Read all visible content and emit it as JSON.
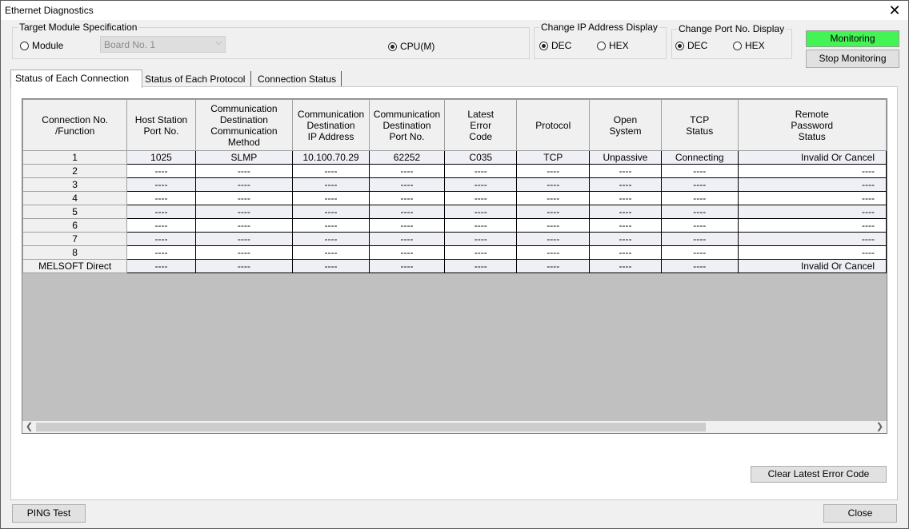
{
  "window": {
    "title": "Ethernet Diagnostics",
    "close_glyph": "✕"
  },
  "target": {
    "legend": "Target Module Specification",
    "module_label": "Module",
    "board_value": "Board No. 1",
    "cpu_label": "CPU(M)"
  },
  "ip_display": {
    "legend": "Change IP Address Display",
    "dec": "DEC",
    "hex": "HEX"
  },
  "port_display": {
    "legend": "Change Port No. Display",
    "dec": "DEC",
    "hex": "HEX"
  },
  "buttons": {
    "monitoring": "Monitoring",
    "stop_monitoring": "Stop Monitoring",
    "clear_error": "Clear Latest Error Code",
    "ping": "PING Test",
    "close": "Close"
  },
  "tabs": [
    "Status of Each Connection",
    "Status of Each Protocol",
    "Connection Status"
  ],
  "table": {
    "headers": [
      [
        "Connection No.",
        "/Function"
      ],
      [
        "Host Station",
        "Port No."
      ],
      [
        "Communication",
        "Destination",
        "Communication",
        "Method"
      ],
      [
        "Communication",
        "Destination",
        "IP Address"
      ],
      [
        "Communication",
        "Destination",
        "Port No."
      ],
      [
        "Latest",
        "Error",
        "Code"
      ],
      [
        "Protocol"
      ],
      [
        "Open",
        "System"
      ],
      [
        "TCP",
        "Status"
      ],
      [
        "Remote",
        "Password",
        "Status"
      ]
    ],
    "rows": [
      [
        "1",
        "1025",
        "SLMP",
        "10.100.70.29",
        "62252",
        "C035",
        "TCP",
        "Unpassive",
        "Connecting",
        "Invalid Or Cancel"
      ],
      [
        "2",
        "----",
        "----",
        "----",
        "----",
        "----",
        "----",
        "----",
        "----",
        "----"
      ],
      [
        "3",
        "----",
        "----",
        "----",
        "----",
        "----",
        "----",
        "----",
        "----",
        "----"
      ],
      [
        "4",
        "----",
        "----",
        "----",
        "----",
        "----",
        "----",
        "----",
        "----",
        "----"
      ],
      [
        "5",
        "----",
        "----",
        "----",
        "----",
        "----",
        "----",
        "----",
        "----",
        "----"
      ],
      [
        "6",
        "----",
        "----",
        "----",
        "----",
        "----",
        "----",
        "----",
        "----",
        "----"
      ],
      [
        "7",
        "----",
        "----",
        "----",
        "----",
        "----",
        "----",
        "----",
        "----",
        "----"
      ],
      [
        "8",
        "----",
        "----",
        "----",
        "----",
        "----",
        "----",
        "----",
        "----",
        "----"
      ],
      [
        "MELSOFT Direct",
        "----",
        "----",
        "----",
        "----",
        "----",
        "----",
        "----",
        "----",
        "Invalid Or Cancel"
      ]
    ]
  },
  "colors": {
    "monitoring_bg": "#44f454"
  },
  "icons": {
    "scroll_left": "chevron-left-icon",
    "scroll_right": "chevron-right-icon",
    "combo_arrow": "chevron-down-icon"
  }
}
